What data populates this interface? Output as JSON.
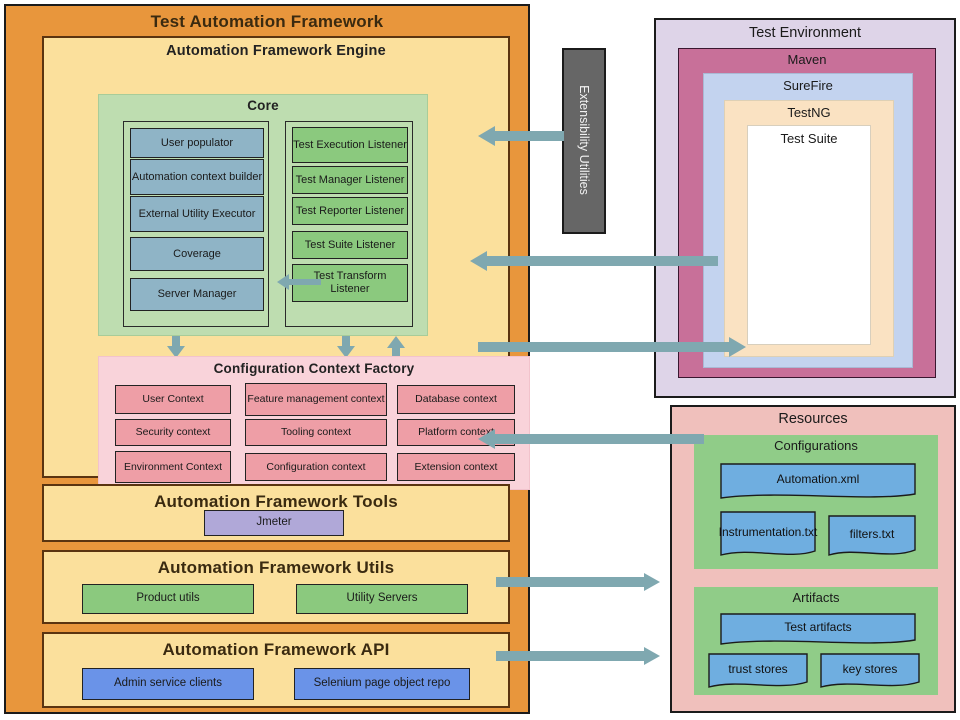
{
  "colors": {
    "framework_orange": "#E8963C",
    "panel_yellow": "#FBE09C",
    "core_green": "#BEDDB0",
    "blue_cell": "#8FB4C6",
    "green_cell": "#8BC97E",
    "ccf_pink": "#F9D3DA",
    "ctx_cell": "#EE9EA6",
    "jmeter_purple": "#B0A8D8",
    "api_blue": "#6A93E8",
    "env_lavender": "#DED4E8",
    "maven_mauve": "#C87099",
    "surefire_blue": "#C3D3EF",
    "testng_peach": "#FAE2C2",
    "testsuite_white": "#FFFFFF",
    "resources_salmon": "#F0C0BC",
    "resources_green": "#90CC88",
    "file_blue": "#6FAEE0",
    "arrow_teal": "#7FA8B0",
    "extensibility_gray": "#666666"
  },
  "framework": {
    "title": "Test Automation Framework",
    "engine": {
      "title": "Automation Framework Engine",
      "core": {
        "title": "Core",
        "left_components": [
          "User populator",
          "Automation context builder",
          "External Utility Executor",
          "Coverage",
          "Server Manager"
        ],
        "right_components": [
          "Test Execution Listener",
          "Test Manager Listener",
          "Test Reporter Listener",
          "Test Suite Listener",
          "Test Transform Listener"
        ]
      },
      "context_factory": {
        "title": "Configuration Context Factory",
        "contexts": [
          "User Context",
          "Feature management context",
          "Database context",
          "Security context",
          "Tooling context",
          "Platform context",
          "Environment Context",
          "Configuration context",
          "Extension context"
        ]
      }
    },
    "tools": {
      "title": "Automation Framework Tools",
      "items": [
        "Jmeter"
      ]
    },
    "utils": {
      "title": "Automation Framework Utils",
      "items": [
        "Product utils",
        "Utility Servers"
      ]
    },
    "api": {
      "title": "Automation Framework API",
      "items": [
        "Admin service clients",
        "Selenium page object repo"
      ]
    }
  },
  "extensibility": {
    "label": "Extensibility Utilities"
  },
  "test_environment": {
    "title": "Test Environment",
    "maven": {
      "title": "Maven",
      "surefire": {
        "title": "SureFire",
        "testng": {
          "title": "TestNG",
          "test_suite": {
            "title": "Test Suite"
          }
        }
      }
    }
  },
  "resources": {
    "title": "Resources",
    "configurations": {
      "title": "Configurations",
      "files": [
        "Automation.xml",
        "Instrumentation.txt",
        "filters.txt"
      ]
    },
    "artifacts": {
      "title": "Artifacts",
      "files": [
        "Test artifacts",
        "trust stores",
        "key stores"
      ]
    }
  },
  "connectors": [
    {
      "name": "extensibility-to-listeners",
      "direction": "left"
    },
    {
      "name": "test-suite-to-listeners",
      "direction": "left"
    },
    {
      "name": "context-factory-to-test-suite",
      "direction": "right"
    },
    {
      "name": "resources-to-context-factory",
      "direction": "left"
    },
    {
      "name": "utils-to-artifacts",
      "direction": "right"
    },
    {
      "name": "api-to-artifacts",
      "direction": "right"
    },
    {
      "name": "listeners-to-external-utility-executor",
      "direction": "left"
    },
    {
      "name": "core-to-context-factory",
      "direction": "down"
    },
    {
      "name": "listeners-to-context-factory",
      "direction": "down"
    },
    {
      "name": "context-factory-to-listeners",
      "direction": "up"
    }
  ]
}
